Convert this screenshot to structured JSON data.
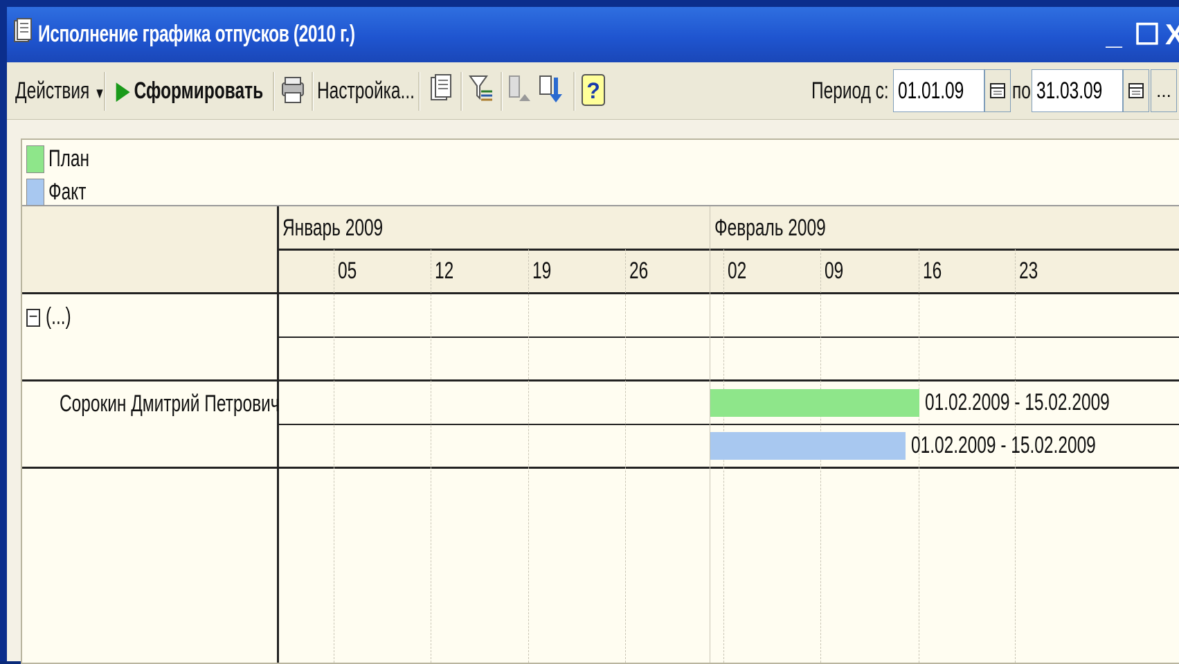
{
  "window": {
    "title": "Исполнение графика отпусков (2010 г.)",
    "controls": [
      "_",
      "☐",
      "X"
    ]
  },
  "toolbar": {
    "actions_label": "Действия",
    "form_label": "Сформировать",
    "settings_label": "Настройка...",
    "period_from_label": "Период с:",
    "period_from_value": "01.01.09",
    "period_to_label": "по:",
    "period_to_value": "31.03.09",
    "more_label": "..."
  },
  "legend": [
    {
      "label": "План",
      "color": "#8ee68a"
    },
    {
      "label": "Факт",
      "color": "#a8c8f0"
    }
  ],
  "gantt": {
    "months": [
      "Январь 2009",
      "Февраль 2009"
    ],
    "weeks": [
      "05",
      "12",
      "19",
      "26",
      "02",
      "09",
      "16",
      "23"
    ],
    "group_label": "(...)",
    "employee": "Сорокин Дмитрий Петрович",
    "plan_range": "01.02.2009 - 15.02.2009",
    "fact_range": "01.02.2009 - 15.02.2009",
    "plan_color": "#8ee68a",
    "fact_color": "#a8c8f0"
  }
}
